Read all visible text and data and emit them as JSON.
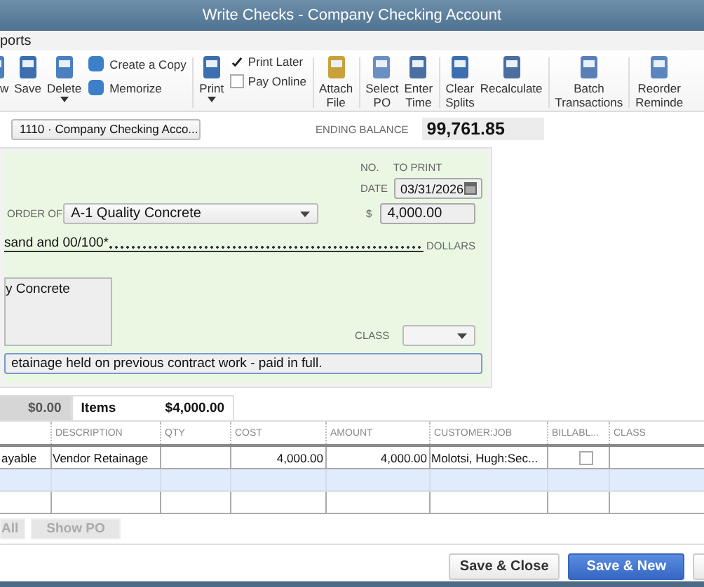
{
  "window": {
    "title": "Write Checks - Company Checking Account"
  },
  "menu": [
    {
      "label": "ports"
    }
  ],
  "toolbar": [
    {
      "kind": "button",
      "label": "w"
    },
    {
      "kind": "button",
      "label": "Save"
    },
    {
      "kind": "button",
      "label": "Delete",
      "menu": true
    },
    {
      "kind": "stack",
      "items": [
        {
          "label": "Create a Copy"
        },
        {
          "label": "Memorize"
        }
      ]
    },
    {
      "kind": "divider"
    },
    {
      "kind": "button",
      "label": "Print",
      "menu": true
    },
    {
      "kind": "checks",
      "items": [
        {
          "label": "Print Later",
          "checked": true
        },
        {
          "label": "Pay Online",
          "checked": false
        }
      ]
    },
    {
      "kind": "divider"
    },
    {
      "kind": "button",
      "label": "Attach File"
    },
    {
      "kind": "divider"
    },
    {
      "kind": "button",
      "label": "Select PO"
    },
    {
      "kind": "button",
      "label": "Enter Time"
    },
    {
      "kind": "divider"
    },
    {
      "kind": "button",
      "label": "Clear Splits"
    },
    {
      "kind": "button",
      "label": "Recalculate"
    },
    {
      "kind": "divider"
    },
    {
      "kind": "button",
      "label": "Batch Transactions"
    },
    {
      "kind": "divider"
    },
    {
      "kind": "button",
      "label": "Reorder Reminde"
    }
  ],
  "account": {
    "value": "1110 · Company Checking Acco...",
    "ending_balance_label": "ENDING BALANCE",
    "ending_balance": "99,761.85"
  },
  "check": {
    "no_label": "NO.",
    "no_value": "TO PRINT",
    "date_label": "DATE",
    "date": "03/31/2026",
    "payee_label": "ORDER OF",
    "payee": "A-1 Quality Concrete",
    "amount_label": "$",
    "amount": "4,000.00",
    "amount_words": "sand  and 00/100*",
    "dollars_label": "DOLLARS",
    "address": "y Concrete",
    "class_label": "CLASS",
    "memo": "etainage held on previous contract work - paid in full."
  },
  "tabs": [
    {
      "label": "$0.00",
      "selected": false
    },
    {
      "label": "Items",
      "amount": "$4,000.00",
      "selected": true
    }
  ],
  "table": {
    "columns": [
      "",
      "DESCRIPTION",
      "QTY",
      "COST",
      "AMOUNT",
      "CUSTOMER:JOB",
      "BILLABL...",
      "CLASS"
    ],
    "rows": [
      {
        "cells": [
          "ayable",
          "Vendor Retainage",
          "",
          "4,000.00",
          "4,000.00",
          "Molotsi, Hugh:Sec...",
          "",
          ""
        ],
        "billable": false,
        "selected": false
      },
      {
        "cells": [
          "",
          "",
          "",
          "",
          "",
          "",
          "",
          ""
        ],
        "selected": true
      },
      {
        "cells": [
          "",
          "",
          "",
          "",
          "",
          "",
          "",
          ""
        ],
        "selected": false
      }
    ]
  },
  "item_buttons": [
    {
      "label": "All",
      "disabled": true
    },
    {
      "label": "Show PO",
      "disabled": true
    }
  ],
  "footer_buttons": [
    {
      "label": "Save & Close",
      "kind": "secondary"
    },
    {
      "label": "Save & New",
      "kind": "primary"
    },
    {
      "kind": "secondary"
    }
  ]
}
